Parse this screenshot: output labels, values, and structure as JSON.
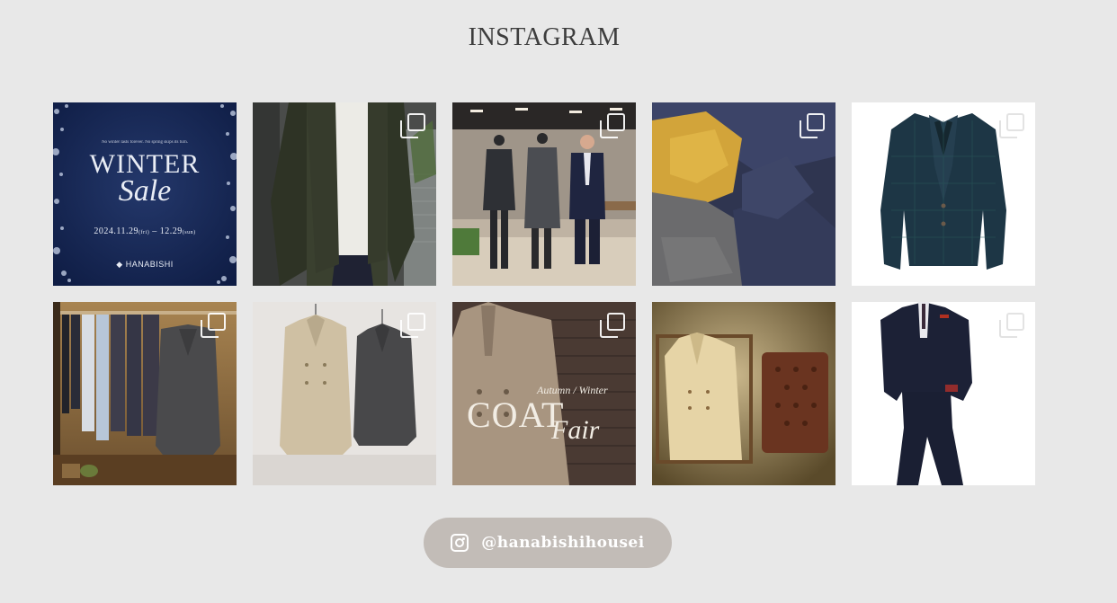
{
  "section": {
    "title": "INSTAGRAM"
  },
  "posts": [
    {
      "id": "winter-sale",
      "tagline": "No winter lasts forever. No spring skips its turn.",
      "headline": "WINTER",
      "script": "Sale",
      "dates": "2024.11.29",
      "dates_small_1": "(fri)",
      "dates_dash": " – 12.29",
      "dates_small_2": "(sun)",
      "brand": "HANABISHI",
      "multi": false
    },
    {
      "id": "corduroy-jacket",
      "multi": true
    },
    {
      "id": "store-mannequins",
      "multi": true
    },
    {
      "id": "fabric-swatches",
      "multi": true
    },
    {
      "id": "tweed-jacket",
      "multi": true
    },
    {
      "id": "coat-rack",
      "multi": true
    },
    {
      "id": "two-coats",
      "multi": true
    },
    {
      "id": "coat-fair",
      "subtitle": "Autumn / Winter",
      "headline": "COAT",
      "script": "Fair",
      "multi": true
    },
    {
      "id": "camel-coat-chair",
      "multi": false
    },
    {
      "id": "navy-suit",
      "multi": true
    }
  ],
  "follow": {
    "handle": "@hanabishihousei",
    "icon": "instagram-icon"
  },
  "colors": {
    "background": "#e8e8e8",
    "button": "#c2bcb7",
    "title": "#3d3d3d"
  }
}
